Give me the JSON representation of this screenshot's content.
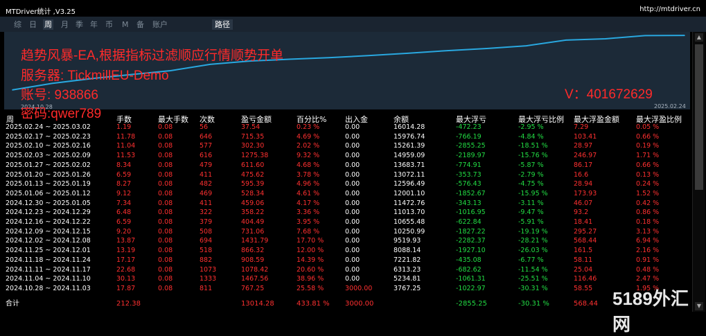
{
  "window": {
    "title": "MTDriver统计 ,V3.25",
    "url": "http://mtdriver.cn"
  },
  "tabs": [
    "综",
    "日",
    "周",
    "月",
    "季",
    "年",
    "币",
    "M",
    "备",
    "账户"
  ],
  "active_tab": "周",
  "route_tab": "路径",
  "overlay": {
    "line1": "趋势风暴-EA,根据指标过滤顺应行情顺势开单",
    "line2": "服务器: TickmillEU-Demo",
    "line3": "账号: 938866",
    "line4": "密码:qwer789",
    "vx": "V：401672629"
  },
  "chart": {
    "start_date": "2024.10.28",
    "end_date": "2025.02.24",
    "line_color": "#29a8e0"
  },
  "chart_data": {
    "type": "line",
    "x": [
      "2024.10.28",
      "2024.11.04",
      "2024.11.11",
      "2024.11.18",
      "2024.11.25",
      "2024.12.02",
      "2024.12.09",
      "2024.12.16",
      "2024.12.23",
      "2024.12.30",
      "2025.01.06",
      "2025.01.13",
      "2025.01.20",
      "2025.01.27",
      "2025.02.03",
      "2025.02.10",
      "2025.02.17",
      "2025.02.24"
    ],
    "values": [
      3767.25,
      5234.81,
      6313.23,
      7221.82,
      8088.14,
      9519.93,
      10250.99,
      10655.48,
      11013.7,
      11472.76,
      12001.1,
      12596.49,
      13072.11,
      13683.71,
      14959.09,
      15261.39,
      15976.74,
      16014.28
    ]
  },
  "table": {
    "headers": [
      "周",
      "手数",
      "最大手数",
      "次数",
      "盈亏金额",
      "百分比%",
      "出入金",
      "余额",
      "最大浮亏",
      "最大浮亏比例",
      "最大浮盈金额",
      "最大浮盈比例"
    ],
    "rows": [
      [
        "2025.02.24 ~ 2025.03.02",
        "1.19",
        "0.08",
        "56",
        "37.54",
        "0.23 %",
        "0.00",
        "16014.28",
        "-472.23",
        "-2.95 %",
        "7.29",
        "0.05 %"
      ],
      [
        "2025.02.17 ~ 2025.02.23",
        "11.78",
        "0.08",
        "646",
        "715.35",
        "4.69 %",
        "0.00",
        "15976.74",
        "-766.19",
        "-4.84 %",
        "103.41",
        "0.66 %"
      ],
      [
        "2025.02.10 ~ 2025.02.16",
        "11.04",
        "0.08",
        "577",
        "302.30",
        "2.02 %",
        "0.00",
        "15261.39",
        "-2855.25",
        "-18.51 %",
        "28.97",
        "0.19 %"
      ],
      [
        "2025.02.03 ~ 2025.02.09",
        "11.53",
        "0.08",
        "616",
        "1275.38",
        "9.32 %",
        "0.00",
        "14959.09",
        "-2189.97",
        "-15.76 %",
        "246.97",
        "1.71 %"
      ],
      [
        "2025.01.27 ~ 2025.02.02",
        "8.34",
        "0.08",
        "479",
        "611.60",
        "4.68 %",
        "0.00",
        "13683.71",
        "-774.91",
        "-5.87 %",
        "86.17",
        "0.66 %"
      ],
      [
        "2025.01.20 ~ 2025.01.26",
        "6.59",
        "0.08",
        "411",
        "475.62",
        "3.78 %",
        "0.00",
        "13072.11",
        "-353.73",
        "-2.79 %",
        "16.6",
        "0.13 %"
      ],
      [
        "2025.01.13 ~ 2025.01.19",
        "8.27",
        "0.08",
        "482",
        "595.39",
        "4.96 %",
        "0.00",
        "12596.49",
        "-576.43",
        "-4.75 %",
        "28.94",
        "0.24 %"
      ],
      [
        "2025.01.06 ~ 2025.01.12",
        "9.12",
        "0.08",
        "469",
        "528.34",
        "4.61 %",
        "0.00",
        "12001.10",
        "-1852.67",
        "-15.95 %",
        "173.93",
        "1.52 %"
      ],
      [
        "2024.12.30 ~ 2025.01.05",
        "7.34",
        "0.08",
        "411",
        "459.06",
        "4.17 %",
        "0.00",
        "11472.76",
        "-343.13",
        "-3.11 %",
        "46.07",
        "0.42 %"
      ],
      [
        "2024.12.23 ~ 2024.12.29",
        "6.48",
        "0.08",
        "322",
        "358.22",
        "3.36 %",
        "0.00",
        "11013.70",
        "-1016.95",
        "-9.47 %",
        "93.2",
        "0.86 %"
      ],
      [
        "2024.12.16 ~ 2024.12.22",
        "6.59",
        "0.08",
        "379",
        "404.49",
        "3.95 %",
        "0.00",
        "10655.48",
        "-622.84",
        "-5.91 %",
        "18.41",
        "0.18 %"
      ],
      [
        "2024.12.09 ~ 2024.12.15",
        "9.20",
        "0.08",
        "508",
        "731.06",
        "7.68 %",
        "0.00",
        "10250.99",
        "-1827.22",
        "-19.19 %",
        "295.27",
        "3.13 %"
      ],
      [
        "2024.12.02 ~ 2024.12.08",
        "13.87",
        "0.08",
        "694",
        "1431.79",
        "17.70 %",
        "0.00",
        "9519.93",
        "-2282.37",
        "-28.21 %",
        "568.44",
        "6.94 %"
      ],
      [
        "2024.11.25 ~ 2024.12.01",
        "13.19",
        "0.08",
        "518",
        "866.32",
        "12.00 %",
        "0.00",
        "8088.14",
        "-1927.10",
        "-26.03 %",
        "161.5",
        "2.16 %"
      ],
      [
        "2024.11.18 ~ 2024.11.24",
        "17.17",
        "0.08",
        "882",
        "908.59",
        "14.39 %",
        "0.00",
        "7221.82",
        "-435.08",
        "-6.77 %",
        "58.11",
        "0.91 %"
      ],
      [
        "2024.11.11 ~ 2024.11.17",
        "22.68",
        "0.08",
        "1073",
        "1078.42",
        "20.60 %",
        "0.00",
        "6313.23",
        "-682.62",
        "-11.54 %",
        "25.04",
        "0.48 %"
      ],
      [
        "2024.11.04 ~ 2024.11.10",
        "30.13",
        "0.08",
        "1333",
        "1467.56",
        "38.96 %",
        "0.00",
        "5234.81",
        "-1061.31",
        "-25.51 %",
        "116.46",
        "2.47 %"
      ],
      [
        "2024.10.28 ~ 2024.11.03",
        "17.87",
        "0.08",
        "811",
        "767.25",
        "25.58 %",
        "3000.00",
        "3767.25",
        "-1022.97",
        "-30.31 %",
        "58.55",
        "1.95 %"
      ]
    ],
    "total": [
      "合计",
      "212.38",
      "",
      "",
      "13014.28",
      "433.81 %",
      "3000.00",
      "",
      "-2855.25",
      "-30.31 %",
      "568.44",
      ""
    ]
  },
  "watermark": "5189外汇网",
  "colors": {
    "positive": "#ff3030",
    "negative": "#22dd44",
    "chart_bg": "#1c2a38"
  }
}
